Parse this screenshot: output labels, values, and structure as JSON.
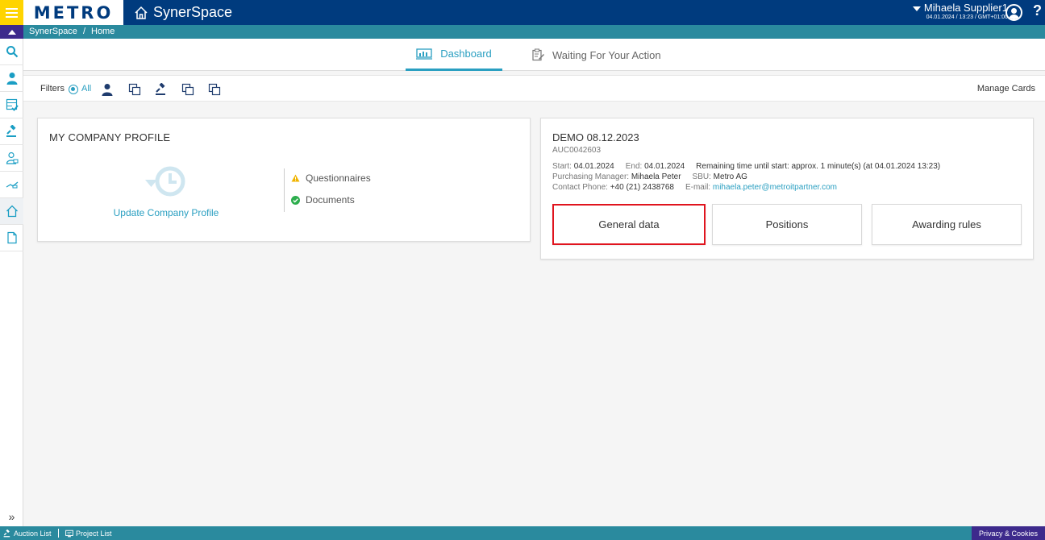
{
  "header": {
    "logo": "METRO",
    "app_title": "SynerSpace",
    "user_name": "Mihaela Supplier1",
    "user_time": "04.01.2024 / 13:23 / GMT+01:00",
    "help": "?"
  },
  "breadcrumb": {
    "root": "SynerSpace",
    "separator": "/",
    "current": "Home"
  },
  "tabs": [
    {
      "label": "Dashboard",
      "active": true
    },
    {
      "label": "Waiting For Your Action",
      "active": false
    }
  ],
  "filters": {
    "label": "Filters",
    "all_label": "All",
    "manage_cards": "Manage Cards"
  },
  "profile_card": {
    "title": "MY COMPANY PROFILE",
    "update_link": "Update Company Profile",
    "questionnaires": "Questionnaires",
    "documents": "Documents"
  },
  "auction_card": {
    "title": "DEMO 08.12.2023",
    "code": "AUC0042603",
    "start_label": "Start:",
    "start_value": "04.01.2024",
    "end_label": "End:",
    "end_value": "04.01.2024",
    "remaining": "Remaining time until start: approx. 1 minute(s) (at 04.01.2024 13:23)",
    "manager_label": "Purchasing Manager:",
    "manager_value": "Mihaela Peter",
    "sbu_label": "SBU:",
    "sbu_value": "Metro AG",
    "phone_label": "Contact Phone:",
    "phone_value": "+40 (21) 2438768",
    "email_label": "E-mail:",
    "email_value": "mihaela.peter@metroitpartner.com",
    "buttons": {
      "general": "General data",
      "positions": "Positions",
      "awarding": "Awarding rules"
    }
  },
  "bottom_bar": {
    "auction_list": "Auction List",
    "project_list": "Project List",
    "privacy": "Privacy & Cookies"
  },
  "colors": {
    "brand_blue": "#003b7e",
    "accent_yellow": "#ffd400",
    "teal": "#2a8a9e",
    "link": "#2a9fc1",
    "highlight_red": "#e0141e",
    "purple": "#3d2a8c"
  }
}
